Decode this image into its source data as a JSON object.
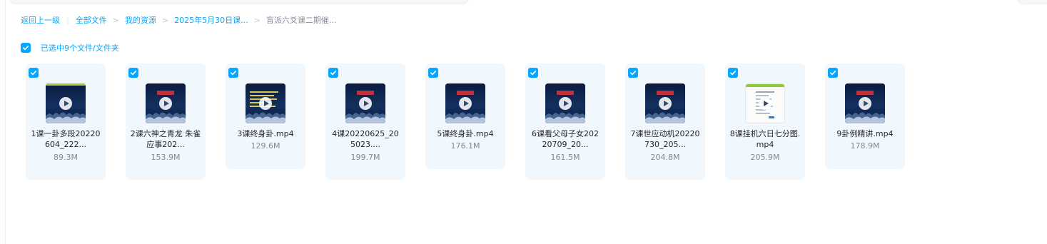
{
  "breadcrumb": {
    "back": "返回上一级",
    "items": [
      "全部文件",
      "我的资源",
      "2025年5月30日课...",
      "盲派六爻课二期催..."
    ]
  },
  "selection": {
    "label": "已选中9个文件/文件夹",
    "checked": true
  },
  "files": [
    {
      "name": "1课一卦多段20220604_222...",
      "size": "89.3M",
      "thumb": "video-blue",
      "checked": true
    },
    {
      "name": "2课六神之青龙 朱雀 应事202...",
      "size": "153.9M",
      "thumb": "video-red",
      "checked": true
    },
    {
      "name": "3课终身卦.mp4",
      "size": "129.6M",
      "thumb": "video-green",
      "checked": true
    },
    {
      "name": "4课20220625_205023....",
      "size": "199.7M",
      "thumb": "video-red",
      "checked": true
    },
    {
      "name": "5课终身卦.mp4",
      "size": "176.1M",
      "thumb": "video-red",
      "checked": true
    },
    {
      "name": "6课看父母子女20220709_20...",
      "size": "161.5M",
      "thumb": "video-red",
      "checked": true
    },
    {
      "name": "7课世应动机20220730_205...",
      "size": "204.8M",
      "thumb": "video-red",
      "checked": true
    },
    {
      "name": "8课挂机六日七分图.mp4",
      "size": "205.9M",
      "thumb": "video-doc",
      "checked": true
    },
    {
      "name": "9卦例精讲.mp4",
      "size": "178.9M",
      "thumb": "video-red",
      "checked": true
    }
  ],
  "colors": {
    "accent": "#06a7ff",
    "card_bg": "#f0f7fd",
    "size_text": "#818999"
  },
  "icons": {
    "checkbox": "checkbox-checked-icon",
    "play": "play-icon",
    "separator": "chevron-right-icon"
  }
}
